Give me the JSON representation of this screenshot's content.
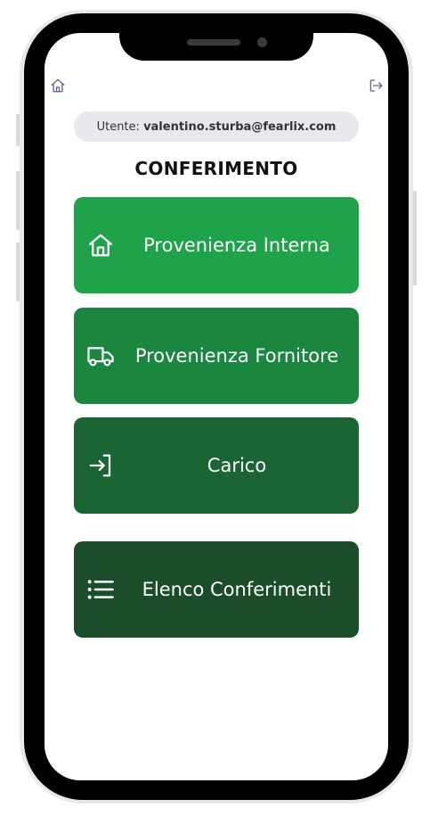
{
  "header": {
    "home_icon": "home-icon",
    "logout_icon": "logout-icon"
  },
  "user": {
    "prefix": "Utente:",
    "email": "valentino.sturba@fearlix.com"
  },
  "page_title": "CONFERIMENTO",
  "menu": [
    {
      "label": "Provenienza Interna",
      "icon": "home-icon",
      "color": "#1fa34a"
    },
    {
      "label": "Provenienza Fornitore",
      "icon": "truck-icon",
      "color": "#1b8640"
    },
    {
      "label": "Carico",
      "icon": "login-arrow-icon",
      "color": "#1b6434"
    },
    {
      "label": "Elenco Conferimenti",
      "icon": "list-icon",
      "color": "#1b4d2b"
    }
  ]
}
